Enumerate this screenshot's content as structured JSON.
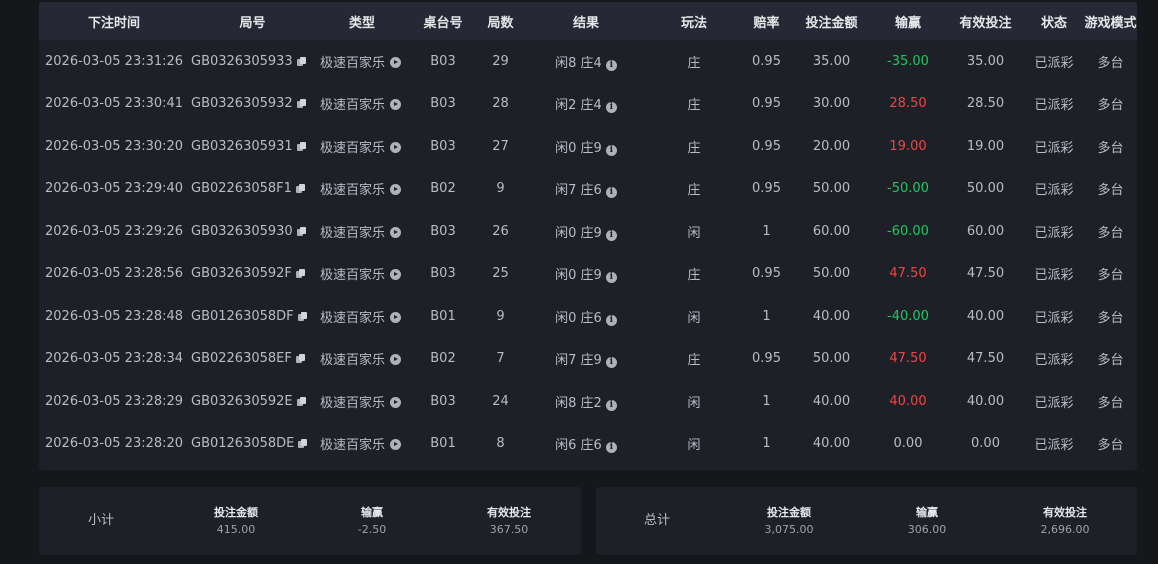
{
  "headers": [
    "下注时间",
    "局号",
    "类型",
    "桌台号",
    "局数",
    "结果",
    "玩法",
    "赔率",
    "投注金额",
    "输赢",
    "有效投注",
    "状态",
    "游戏模式"
  ],
  "rows": [
    {
      "time": "2026-03-05 23:31:26",
      "round": "GB0326305933",
      "type": "极速百家乐",
      "table": "B03",
      "game": "29",
      "result": "闲8 庄4",
      "play": "庄",
      "odds": "0.95",
      "bet": "35.00",
      "winloss": "-35.00",
      "wl_sign": "neg",
      "valid": "35.00",
      "status": "已派彩",
      "mode": "多台"
    },
    {
      "time": "2026-03-05 23:30:41",
      "round": "GB0326305932",
      "type": "极速百家乐",
      "table": "B03",
      "game": "28",
      "result": "闲2 庄4",
      "play": "庄",
      "odds": "0.95",
      "bet": "30.00",
      "winloss": "28.50",
      "wl_sign": "pos",
      "valid": "28.50",
      "status": "已派彩",
      "mode": "多台"
    },
    {
      "time": "2026-03-05 23:30:20",
      "round": "GB0326305931",
      "type": "极速百家乐",
      "table": "B03",
      "game": "27",
      "result": "闲0 庄9",
      "play": "庄",
      "odds": "0.95",
      "bet": "20.00",
      "winloss": "19.00",
      "wl_sign": "pos",
      "valid": "19.00",
      "status": "已派彩",
      "mode": "多台"
    },
    {
      "time": "2026-03-05 23:29:40",
      "round": "GB02263058F1",
      "type": "极速百家乐",
      "table": "B02",
      "game": "9",
      "result": "闲7 庄6",
      "play": "庄",
      "odds": "0.95",
      "bet": "50.00",
      "winloss": "-50.00",
      "wl_sign": "neg",
      "valid": "50.00",
      "status": "已派彩",
      "mode": "多台"
    },
    {
      "time": "2026-03-05 23:29:26",
      "round": "GB0326305930",
      "type": "极速百家乐",
      "table": "B03",
      "game": "26",
      "result": "闲0 庄9",
      "play": "闲",
      "odds": "1",
      "bet": "60.00",
      "winloss": "-60.00",
      "wl_sign": "neg",
      "valid": "60.00",
      "status": "已派彩",
      "mode": "多台"
    },
    {
      "time": "2026-03-05 23:28:56",
      "round": "GB032630592F",
      "type": "极速百家乐",
      "table": "B03",
      "game": "25",
      "result": "闲0 庄9",
      "play": "庄",
      "odds": "0.95",
      "bet": "50.00",
      "winloss": "47.50",
      "wl_sign": "pos",
      "valid": "47.50",
      "status": "已派彩",
      "mode": "多台"
    },
    {
      "time": "2026-03-05 23:28:48",
      "round": "GB01263058DF",
      "type": "极速百家乐",
      "table": "B01",
      "game": "9",
      "result": "闲0 庄6",
      "play": "闲",
      "odds": "1",
      "bet": "40.00",
      "winloss": "-40.00",
      "wl_sign": "neg",
      "valid": "40.00",
      "status": "已派彩",
      "mode": "多台"
    },
    {
      "time": "2026-03-05 23:28:34",
      "round": "GB02263058EF",
      "type": "极速百家乐",
      "table": "B02",
      "game": "7",
      "result": "闲7 庄9",
      "play": "庄",
      "odds": "0.95",
      "bet": "50.00",
      "winloss": "47.50",
      "wl_sign": "pos",
      "valid": "47.50",
      "status": "已派彩",
      "mode": "多台"
    },
    {
      "time": "2026-03-05 23:28:29",
      "round": "GB032630592E",
      "type": "极速百家乐",
      "table": "B03",
      "game": "24",
      "result": "闲8 庄2",
      "play": "闲",
      "odds": "1",
      "bet": "40.00",
      "winloss": "40.00",
      "wl_sign": "pos",
      "valid": "40.00",
      "status": "已派彩",
      "mode": "多台"
    },
    {
      "time": "2026-03-05 23:28:20",
      "round": "GB01263058DE",
      "type": "极速百家乐",
      "table": "B01",
      "game": "8",
      "result": "闲6 庄6",
      "play": "闲",
      "odds": "1",
      "bet": "40.00",
      "winloss": "0.00",
      "wl_sign": "zero",
      "valid": "0.00",
      "status": "已派彩",
      "mode": "多台"
    }
  ],
  "subtotal": {
    "label": "小计",
    "bet_label": "投注金额",
    "bet": "415.00",
    "wl_label": "输赢",
    "wl": "-2.50",
    "valid_label": "有效投注",
    "valid": "367.50"
  },
  "total": {
    "label": "总计",
    "bet_label": "投注金额",
    "bet": "3,075.00",
    "wl_label": "输赢",
    "wl": "306.00",
    "valid_label": "有效投注",
    "valid": "2,696.00"
  },
  "colors": {
    "negative": "#22c55e",
    "positive": "#ef4444",
    "panel": "#1e2028",
    "header": "#262935"
  }
}
